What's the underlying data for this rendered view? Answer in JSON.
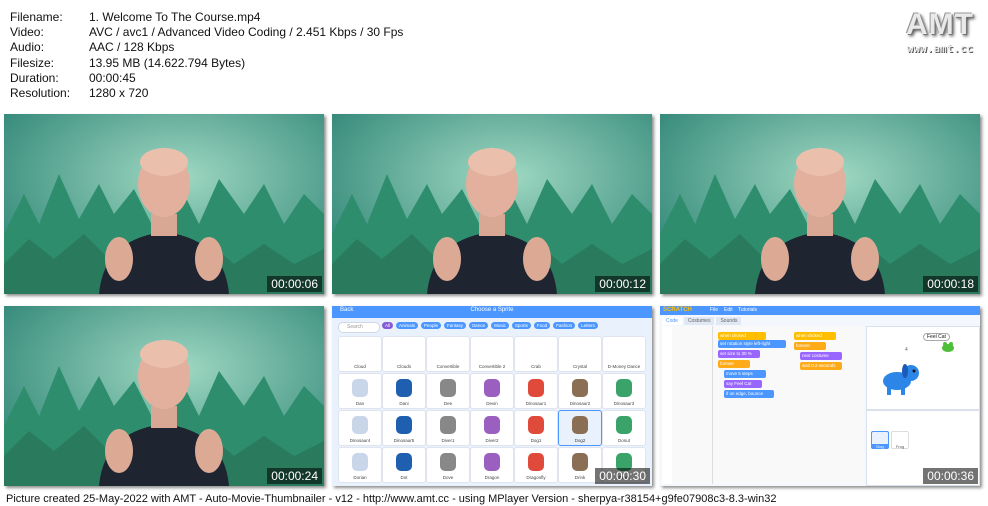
{
  "info": {
    "filename_label": "Filename:",
    "filename": "1. Welcome To The Course.mp4",
    "video_label": "Video:",
    "video": "AVC / avc1 / Advanced Video Coding / 2.451 Kbps / 30 Fps",
    "audio_label": "Audio:",
    "audio": "AAC / 128 Kbps",
    "filesize_label": "Filesize:",
    "filesize": "13.95 MB (14.622.794 Bytes)",
    "duration_label": "Duration:",
    "duration": "00:00:45",
    "resolution_label": "Resolution:",
    "resolution": "1280 x 720"
  },
  "logo": {
    "big": "AMT",
    "small": "www.amt.cc"
  },
  "thumbnails": [
    {
      "time": "00:00:06",
      "kind": "presenter"
    },
    {
      "time": "00:00:12",
      "kind": "presenter"
    },
    {
      "time": "00:00:18",
      "kind": "presenter"
    },
    {
      "time": "00:00:24",
      "kind": "presenter"
    },
    {
      "time": "00:00:30",
      "kind": "sprite-library"
    },
    {
      "time": "00:00:36",
      "kind": "code-editor"
    }
  ],
  "sprite_library": {
    "back_label": "Back",
    "title": "Choose a Sprite",
    "search_placeholder": "Search",
    "categories": [
      "All",
      "Animals",
      "People",
      "Fantasy",
      "Dance",
      "Music",
      "Sports",
      "Food",
      "Fashion",
      "Letters"
    ],
    "sprites": [
      "Cloud",
      "Clouds",
      "Convertible",
      "Convertible 2",
      "Crab",
      "Crystal",
      "D-Money Dance",
      "Dan",
      "Dani",
      "Dee",
      "Devin",
      "Dinosaur1",
      "Dinosaur2",
      "Dinosaur3",
      "Dinosaur4",
      "Dinosaur5",
      "Diver1",
      "Diver2",
      "Dog1",
      "Dog2",
      "Donut",
      "Dorian",
      "Dot",
      "Dove",
      "Dragon",
      "Dragonfly",
      "Drink",
      "Drum"
    ]
  },
  "code_editor": {
    "tabs": [
      "Code",
      "Costumes",
      "Sounds"
    ],
    "menu": [
      "File",
      "Edit",
      "Tutorials"
    ],
    "blocks": [
      "when clicked",
      "set rotation style left-right",
      "set size to 30 %",
      "forever",
      "move 5 steps",
      "say Feel Cat",
      "if on edge, bounce",
      "when clicked",
      "forever",
      "next costume",
      "wait 0.2 seconds"
    ],
    "stage_bubble": "Feel Cat",
    "stage_number": "4",
    "sprite_names": [
      "Dog",
      "Frog"
    ]
  },
  "footer": "Picture created 25-May-2022 with AMT - Auto-Movie-Thumbnailer - v12 - http://www.amt.cc - using MPlayer Version - sherpya-r38154+g9fe07908c3-8.3-win32"
}
